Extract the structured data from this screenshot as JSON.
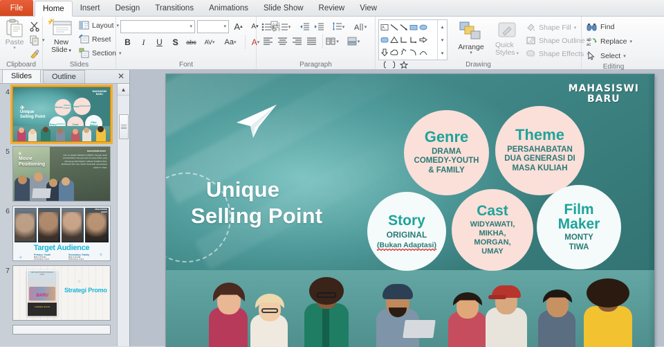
{
  "app": {
    "tabs": [
      {
        "label": "File",
        "active": false,
        "id": "file"
      },
      {
        "label": "Home",
        "active": true,
        "id": "home"
      },
      {
        "label": "Insert",
        "active": false,
        "id": "insert"
      },
      {
        "label": "Design",
        "active": false,
        "id": "design"
      },
      {
        "label": "Transitions",
        "active": false,
        "id": "transitions"
      },
      {
        "label": "Animations",
        "active": false,
        "id": "animations"
      },
      {
        "label": "Slide Show",
        "active": false,
        "id": "slide-show"
      },
      {
        "label": "Review",
        "active": false,
        "id": "review"
      },
      {
        "label": "View",
        "active": false,
        "id": "view"
      }
    ]
  },
  "ribbon": {
    "clipboard": {
      "label": "Clipboard",
      "paste": "Paste",
      "cut": "Cut",
      "copy": "Copy",
      "format_painter": "Format Painter"
    },
    "slides": {
      "label": "Slides",
      "new_slide_line1": "New",
      "new_slide_line2": "Slide",
      "layout": "Layout",
      "reset": "Reset",
      "section": "Section"
    },
    "font": {
      "label": "Font",
      "font_name_value": "",
      "font_size_value": "",
      "grow_font": "A",
      "shrink_font": "A",
      "clear_formatting": "Clear All Formatting",
      "bold": "B",
      "italic": "I",
      "underline": "U",
      "shadow": "S",
      "strikethrough": "abc",
      "character_spacing": "AV",
      "change_case": "Aa",
      "font_color": "A"
    },
    "paragraph": {
      "label": "Paragraph"
    },
    "drawing": {
      "label": "Drawing",
      "arrange": "Arrange",
      "quick_styles_line1": "Quick",
      "quick_styles_line2": "Styles",
      "shape_fill": "Shape Fill",
      "shape_outline": "Shape Outline",
      "shape_effects": "Shape Effects"
    },
    "editing": {
      "label": "Editing",
      "find": "Find",
      "replace": "Replace",
      "select": "Select"
    }
  },
  "left_pane": {
    "tabs": [
      {
        "label": "Slides",
        "active": true
      },
      {
        "label": "Outline",
        "active": false
      }
    ],
    "close": "✕",
    "thumbnails": [
      {
        "number": "4",
        "selected": true,
        "title": "Unique Selling Point"
      },
      {
        "number": "5",
        "selected": false,
        "title": "Movie Positioning"
      },
      {
        "number": "6",
        "selected": false,
        "title": "Target Audience"
      },
      {
        "number": "7",
        "selected": false,
        "title": "Strategi Promo"
      }
    ],
    "thumb5_text": "Movie\nPositioning",
    "thumb6_text": "Target Audience",
    "thumb6_sub_left": "Primary: Youth",
    "thumb6_sub_right": "Secondary: Family",
    "thumb7_text": "Strategi Promo",
    "thumb7_poster": "MAHASISWI BARU"
  },
  "slide": {
    "logo_line1": "MAHASISWI",
    "logo_line2": "BARU",
    "title_line1": "Unique",
    "title_line2": "Selling Point",
    "circles": [
      {
        "id": "genre",
        "heading": "Genre",
        "body_lines": [
          "DRAMA",
          "COMEDY-YOUTH",
          "& FAMILY"
        ],
        "fill": "#fbdfd9",
        "style": "pink"
      },
      {
        "id": "theme",
        "heading": "Theme",
        "body_lines": [
          "PERSAHABATAN",
          "DUA GENERASI DI",
          "MASA KULIAH"
        ],
        "fill": "#fbdfd9",
        "style": "pink"
      },
      {
        "id": "story",
        "heading": "Story",
        "body_lines": [
          "ORIGINAL"
        ],
        "misspelled_line": "(Bukan Adaptasi)",
        "fill": "#f4fbfa",
        "style": "white"
      },
      {
        "id": "cast",
        "heading": "Cast",
        "body_lines": [
          "WIDYAWATI,",
          "MIKHA,",
          "MORGAN,",
          "UMAY"
        ],
        "fill": "#fbdfd9",
        "style": "pink"
      },
      {
        "id": "film-maker",
        "heading_line1": "Film",
        "heading_line2": "Maker",
        "body_lines": [
          "MONTY",
          "TIWA"
        ],
        "fill": "#f4fbfa",
        "style": "white"
      }
    ]
  },
  "colors": {
    "file_tab": "#d4471f",
    "slide_bg_teal": "#3f8585",
    "circle_pink": "#fbdfd9",
    "circle_white": "#f4fbfa",
    "heading_teal": "#1fa39a",
    "body_teal": "#2a7a76",
    "selection_orange": "#f2ad33",
    "spellcheck_red": "#e02b2b"
  }
}
